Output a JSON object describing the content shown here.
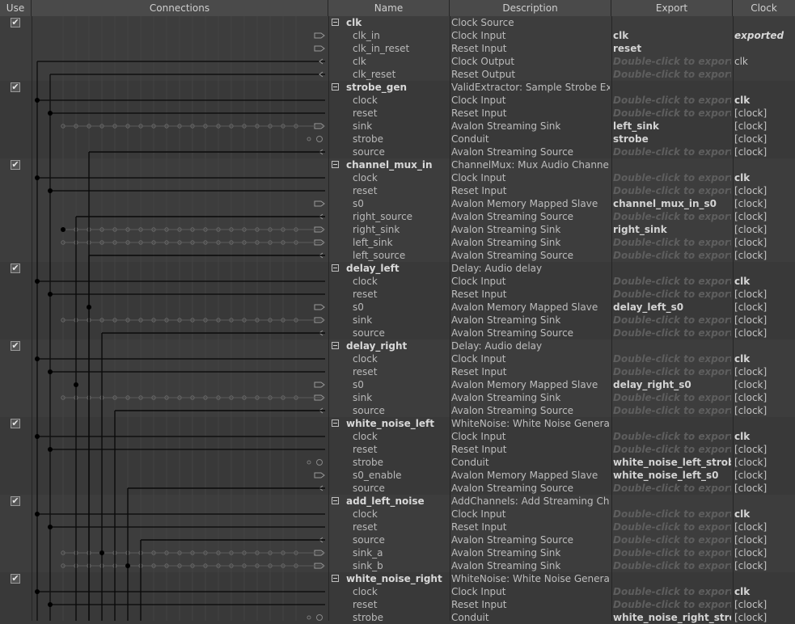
{
  "headers": {
    "use": "Use",
    "connections": "Connections",
    "name": "Name",
    "description": "Description",
    "export": "Export",
    "clock": "Clock"
  },
  "check_mark": "✔",
  "rows": [
    {
      "kind": "module",
      "name": "clk",
      "desc": "Clock Source",
      "export": "",
      "clock": ""
    },
    {
      "kind": "port",
      "name": "clk_in",
      "desc": "Clock Input",
      "export": "clk",
      "hint": false,
      "clock": "exported",
      "clockStyle": "ital"
    },
    {
      "kind": "port",
      "name": "clk_in_reset",
      "desc": "Reset Input",
      "export": "reset",
      "hint": false,
      "clock": ""
    },
    {
      "kind": "port",
      "name": "clk",
      "desc": "Clock Output",
      "export": "Double-click to export",
      "hint": true,
      "clock": "clk"
    },
    {
      "kind": "port",
      "name": "clk_reset",
      "desc": "Reset Output",
      "export": "Double-click to export",
      "hint": true,
      "clock": ""
    },
    {
      "kind": "module",
      "name": "strobe_gen",
      "desc": "ValidExtractor: Sample Strobe Extr...",
      "export": "",
      "clock": ""
    },
    {
      "kind": "port",
      "name": "clock",
      "desc": "Clock Input",
      "export": "Double-click to export",
      "hint": true,
      "clock": "clk",
      "clockStyle": "bold"
    },
    {
      "kind": "port",
      "name": "reset",
      "desc": "Reset Input",
      "export": "Double-click to export",
      "hint": true,
      "clock": "[clock]"
    },
    {
      "kind": "port",
      "name": "sink",
      "desc": "Avalon Streaming Sink",
      "export": "left_sink",
      "hint": false,
      "clock": "[clock]"
    },
    {
      "kind": "port",
      "name": "strobe",
      "desc": "Conduit",
      "export": "strobe",
      "hint": false,
      "clock": "[clock]"
    },
    {
      "kind": "port",
      "name": "source",
      "desc": "Avalon Streaming Source",
      "export": "Double-click to export",
      "hint": true,
      "clock": "[clock]"
    },
    {
      "kind": "module",
      "name": "channel_mux_in",
      "desc": "ChannelMux: Mux Audio Channels",
      "export": "",
      "clock": ""
    },
    {
      "kind": "port",
      "name": "clock",
      "desc": "Clock Input",
      "export": "Double-click to export",
      "hint": true,
      "clock": "clk",
      "clockStyle": "bold"
    },
    {
      "kind": "port",
      "name": "reset",
      "desc": "Reset Input",
      "export": "Double-click to export",
      "hint": true,
      "clock": "[clock]"
    },
    {
      "kind": "port",
      "name": "s0",
      "desc": "Avalon Memory Mapped Slave",
      "export": "channel_mux_in_s0",
      "hint": false,
      "clock": "[clock]"
    },
    {
      "kind": "port",
      "name": "right_source",
      "desc": "Avalon Streaming Source",
      "export": "Double-click to export",
      "hint": true,
      "clock": "[clock]"
    },
    {
      "kind": "port",
      "name": "right_sink",
      "desc": "Avalon Streaming Sink",
      "export": "right_sink",
      "hint": false,
      "clock": "[clock]"
    },
    {
      "kind": "port",
      "name": "left_sink",
      "desc": "Avalon Streaming Sink",
      "export": "Double-click to export",
      "hint": true,
      "clock": "[clock]"
    },
    {
      "kind": "port",
      "name": "left_source",
      "desc": "Avalon Streaming Source",
      "export": "Double-click to export",
      "hint": true,
      "clock": "[clock]"
    },
    {
      "kind": "module",
      "name": "delay_left",
      "desc": "Delay: Audio delay",
      "export": "",
      "clock": ""
    },
    {
      "kind": "port",
      "name": "clock",
      "desc": "Clock Input",
      "export": "Double-click to export",
      "hint": true,
      "clock": "clk",
      "clockStyle": "bold"
    },
    {
      "kind": "port",
      "name": "reset",
      "desc": "Reset Input",
      "export": "Double-click to export",
      "hint": true,
      "clock": "[clock]"
    },
    {
      "kind": "port",
      "name": "s0",
      "desc": "Avalon Memory Mapped Slave",
      "export": "delay_left_s0",
      "hint": false,
      "clock": "[clock]"
    },
    {
      "kind": "port",
      "name": "sink",
      "desc": "Avalon Streaming Sink",
      "export": "Double-click to export",
      "hint": true,
      "clock": "[clock]"
    },
    {
      "kind": "port",
      "name": "source",
      "desc": "Avalon Streaming Source",
      "export": "Double-click to export",
      "hint": true,
      "clock": "[clock]"
    },
    {
      "kind": "module",
      "name": "delay_right",
      "desc": "Delay: Audio delay",
      "export": "",
      "clock": ""
    },
    {
      "kind": "port",
      "name": "clock",
      "desc": "Clock Input",
      "export": "Double-click to export",
      "hint": true,
      "clock": "clk",
      "clockStyle": "bold"
    },
    {
      "kind": "port",
      "name": "reset",
      "desc": "Reset Input",
      "export": "Double-click to export",
      "hint": true,
      "clock": "[clock]"
    },
    {
      "kind": "port",
      "name": "s0",
      "desc": "Avalon Memory Mapped Slave",
      "export": "delay_right_s0",
      "hint": false,
      "clock": "[clock]"
    },
    {
      "kind": "port",
      "name": "sink",
      "desc": "Avalon Streaming Sink",
      "export": "Double-click to export",
      "hint": true,
      "clock": "[clock]"
    },
    {
      "kind": "port",
      "name": "source",
      "desc": "Avalon Streaming Source",
      "export": "Double-click to export",
      "hint": true,
      "clock": "[clock]"
    },
    {
      "kind": "module",
      "name": "white_noise_left",
      "desc": "WhiteNoise: White Noise Generator",
      "export": "",
      "clock": ""
    },
    {
      "kind": "port",
      "name": "clock",
      "desc": "Clock Input",
      "export": "Double-click to export",
      "hint": true,
      "clock": "clk",
      "clockStyle": "bold"
    },
    {
      "kind": "port",
      "name": "reset",
      "desc": "Reset Input",
      "export": "Double-click to export",
      "hint": true,
      "clock": "[clock]"
    },
    {
      "kind": "port",
      "name": "strobe",
      "desc": "Conduit",
      "export": "white_noise_left_strobe",
      "hint": false,
      "clock": "[clock]"
    },
    {
      "kind": "port",
      "name": "s0_enable",
      "desc": "Avalon Memory Mapped Slave",
      "export": "white_noise_left_s0",
      "hint": false,
      "clock": "[clock]"
    },
    {
      "kind": "port",
      "name": "source",
      "desc": "Avalon Streaming Source",
      "export": "Double-click to export",
      "hint": true,
      "clock": "[clock]"
    },
    {
      "kind": "module",
      "name": "add_left_noise",
      "desc": "AddChannels: Add Streaming Cha...",
      "export": "",
      "clock": ""
    },
    {
      "kind": "port",
      "name": "clock",
      "desc": "Clock Input",
      "export": "Double-click to export",
      "hint": true,
      "clock": "clk",
      "clockStyle": "bold"
    },
    {
      "kind": "port",
      "name": "reset",
      "desc": "Reset Input",
      "export": "Double-click to export",
      "hint": true,
      "clock": "[clock]"
    },
    {
      "kind": "port",
      "name": "source",
      "desc": "Avalon Streaming Source",
      "export": "Double-click to export",
      "hint": true,
      "clock": "[clock]"
    },
    {
      "kind": "port",
      "name": "sink_a",
      "desc": "Avalon Streaming Sink",
      "export": "Double-click to export",
      "hint": true,
      "clock": "[clock]"
    },
    {
      "kind": "port",
      "name": "sink_b",
      "desc": "Avalon Streaming Sink",
      "export": "Double-click to export",
      "hint": true,
      "clock": "[clock]"
    },
    {
      "kind": "module",
      "name": "white_noise_right",
      "desc": "WhiteNoise: White Noise Generator",
      "export": "",
      "clock": ""
    },
    {
      "kind": "port",
      "name": "clock",
      "desc": "Clock Input",
      "export": "Double-click to export",
      "hint": true,
      "clock": "clk",
      "clockStyle": "bold"
    },
    {
      "kind": "port",
      "name": "reset",
      "desc": "Reset Input",
      "export": "Double-click to export",
      "hint": true,
      "clock": "[clock]"
    },
    {
      "kind": "port",
      "name": "strobe",
      "desc": "Conduit",
      "export": "white_noise_right_strobe",
      "hint": false,
      "clock": "[clock]"
    }
  ]
}
